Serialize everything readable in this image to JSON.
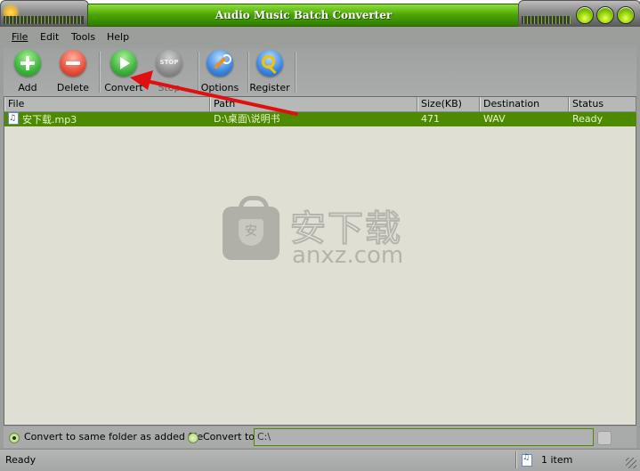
{
  "window": {
    "title": "Audio Music Batch Converter",
    "controls": [
      "minimize",
      "maximize",
      "close"
    ]
  },
  "menu": {
    "items": [
      {
        "label": "File",
        "mnemonic": "F"
      },
      {
        "label": "Edit",
        "mnemonic": "E"
      },
      {
        "label": "Tools",
        "mnemonic": "T"
      },
      {
        "label": "Help",
        "mnemonic": "H"
      }
    ]
  },
  "toolbar": {
    "buttons": [
      {
        "label": "Add",
        "icon": "plus-icon"
      },
      {
        "label": "Delete",
        "icon": "minus-icon"
      },
      {
        "label": "Convert",
        "icon": "play-icon"
      },
      {
        "label": "Stop",
        "icon": "stop-icon",
        "icon_text": "STOP",
        "disabled": true
      },
      {
        "label": "Options",
        "icon": "wrench-icon"
      },
      {
        "label": "Register",
        "icon": "key-icon"
      }
    ]
  },
  "file_list": {
    "columns": [
      "File",
      "Path",
      "Size(KB)",
      "Destination Format",
      "Status"
    ],
    "rows": [
      {
        "file": "安下载.mp3",
        "path": "D:\\桌面\\说明书",
        "size_kb": "471",
        "format": "WAV",
        "status": "Ready",
        "selected": true
      }
    ]
  },
  "watermark": {
    "cn": "安下载",
    "en": "anxz.com",
    "badge": "安"
  },
  "output_options": {
    "same_folder_label": "Convert to same folder as added file",
    "same_folder_selected": true,
    "convert_to_label": "Convert to",
    "convert_to_selected": false,
    "convert_to_path": "C:\\"
  },
  "status_bar": {
    "text": "Ready",
    "item_count": "1 item"
  },
  "colors": {
    "accent_green": "#4e8a00",
    "title_green": "#4aa305",
    "annotation_arrow": "#e01010"
  }
}
